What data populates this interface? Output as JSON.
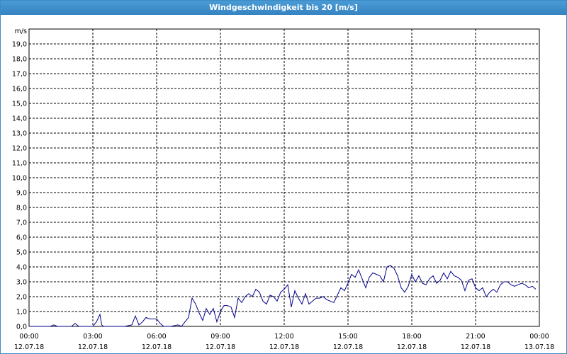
{
  "window": {
    "title": "Windgeschwindigkeit bis 20 [m/s]"
  },
  "chart_data": {
    "type": "line",
    "title": "Windgeschwindigkeit bis 20 [m/s]",
    "ylabel": "m/s",
    "xlabel": "",
    "ylim": [
      0,
      20
    ],
    "xlim": [
      "12.07.18 00:00",
      "13.07.18 00:00"
    ],
    "grid": true,
    "color": "#00008b",
    "y_ticks": [
      "0,0",
      "1,0",
      "2,0",
      "3,0",
      "4,0",
      "5,0",
      "6,0",
      "7,0",
      "8,0",
      "9,0",
      "10,0",
      "11,0",
      "12,0",
      "13,0",
      "14,0",
      "15,0",
      "16,0",
      "17,0",
      "18,0",
      "19,0"
    ],
    "x_ticks": [
      {
        "time": "00:00",
        "date": "12.07.18"
      },
      {
        "time": "03:00",
        "date": "12.07.18"
      },
      {
        "time": "06:00",
        "date": "12.07.18"
      },
      {
        "time": "09:00",
        "date": "12.07.18"
      },
      {
        "time": "12:00",
        "date": "12.07.18"
      },
      {
        "time": "15:00",
        "date": "12.07.18"
      },
      {
        "time": "18:00",
        "date": "12.07.18"
      },
      {
        "time": "21:00",
        "date": "12.07.18"
      },
      {
        "time": "00:00",
        "date": "13.07.18"
      }
    ],
    "series": [
      {
        "x": [
          "00:00",
          "01:00",
          "01:10",
          "01:20",
          "01:30",
          "02:00",
          "02:10",
          "02:20",
          "02:30",
          "03:00",
          "03:10",
          "03:20",
          "03:25",
          "03:30",
          "03:40",
          "04:00",
          "04:30",
          "04:50",
          "05:00",
          "05:10",
          "05:20",
          "05:30",
          "05:40",
          "05:50",
          "06:00",
          "06:10",
          "06:20",
          "06:30",
          "06:40",
          "07:00",
          "07:10",
          "07:20",
          "07:30",
          "07:40",
          "07:50",
          "08:00",
          "08:10",
          "08:20",
          "08:30",
          "08:40",
          "08:50",
          "09:00",
          "09:10",
          "09:20",
          "09:30",
          "09:40",
          "09:50",
          "10:00",
          "10:10",
          "10:20",
          "10:30",
          "10:40",
          "10:50",
          "11:00",
          "11:10",
          "11:20",
          "11:30",
          "11:40",
          "11:50",
          "12:00",
          "12:10",
          "12:20",
          "12:30",
          "12:40",
          "12:50",
          "13:00",
          "13:10",
          "13:20",
          "13:30",
          "13:40",
          "13:50",
          "14:00",
          "14:10",
          "14:20",
          "14:30",
          "14:40",
          "14:50",
          "15:00",
          "15:10",
          "15:20",
          "15:30",
          "15:40",
          "15:50",
          "16:00",
          "16:10",
          "16:20",
          "16:30",
          "16:40",
          "16:50",
          "17:00",
          "17:10",
          "17:20",
          "17:30",
          "17:40",
          "17:50",
          "18:00",
          "18:10",
          "18:20",
          "18:30",
          "18:40",
          "18:50",
          "19:00",
          "19:10",
          "19:20",
          "19:30",
          "19:40",
          "19:50",
          "20:00",
          "20:10",
          "20:20",
          "20:30",
          "20:40",
          "20:50",
          "21:00",
          "21:10",
          "21:20",
          "21:30",
          "21:40",
          "21:50",
          "22:00",
          "22:10",
          "22:20",
          "22:30",
          "22:40",
          "22:50",
          "23:00",
          "23:10",
          "23:20",
          "23:30",
          "23:40",
          "23:50"
        ],
        "values": [
          0,
          0,
          0.1,
          0,
          0,
          0,
          0.2,
          0,
          0,
          0,
          0.3,
          0.8,
          0.1,
          0,
          0,
          0,
          0,
          0.1,
          0.7,
          0.1,
          0.3,
          0.6,
          0.5,
          0.5,
          0.5,
          0.2,
          0,
          0,
          0,
          0.1,
          0,
          0.3,
          0.6,
          1.9,
          1.5,
          0.9,
          0.4,
          1.2,
          0.8,
          1.2,
          0.3,
          1.0,
          1.4,
          1.4,
          1.3,
          0.6,
          1.9,
          1.6,
          2.0,
          2.2,
          2.0,
          2.5,
          2.3,
          1.7,
          1.5,
          2.1,
          2.0,
          1.7,
          2.3,
          2.5,
          2.8,
          1.3,
          2.4,
          1.9,
          1.5,
          2.2,
          1.5,
          1.7,
          1.9,
          1.9,
          2.0,
          1.8,
          1.7,
          1.6,
          2.1,
          2.6,
          2.4,
          2.9,
          3.5,
          3.3,
          3.8,
          3.2,
          2.6,
          3.3,
          3.6,
          3.5,
          3.4,
          3.0,
          4.0,
          4.1,
          3.9,
          3.4,
          2.6,
          2.3,
          2.7,
          3.5,
          3.0,
          3.4,
          2.9,
          2.8,
          3.2,
          3.4,
          2.9,
          3.1,
          3.6,
          3.2,
          3.7,
          3.4,
          3.3,
          3.1,
          2.4,
          3.1,
          3.2,
          2.6,
          2.4,
          2.6,
          2.0,
          2.3,
          2.5,
          2.3,
          2.8,
          3.0,
          3.0,
          2.8,
          2.7,
          2.8,
          2.9,
          2.8,
          2.6,
          2.7,
          2.5
        ]
      }
    ]
  }
}
